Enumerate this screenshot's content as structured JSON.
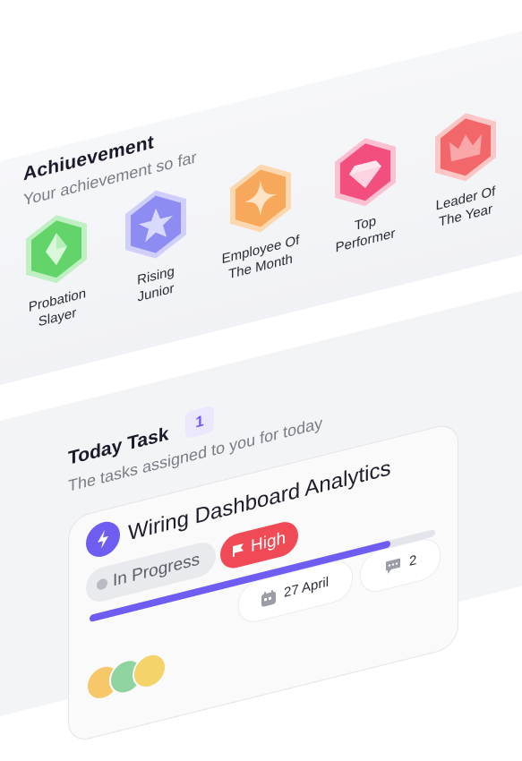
{
  "achievement": {
    "title": "Achiuevement",
    "subtitle": "Your achievement so far",
    "badges": [
      {
        "line1": "Probation",
        "line2": "Slayer",
        "icon": "gem-icon",
        "color": "#62d46a"
      },
      {
        "line1": "Rising",
        "line2": "Junior",
        "icon": "star-icon",
        "color": "#8c8cf2"
      },
      {
        "line1": "Employee Of",
        "line2": "The Month",
        "icon": "sparkle-icon",
        "color": "#f7a85a"
      },
      {
        "line1": "Top",
        "line2": "Performer",
        "icon": "diamond-icon",
        "color": "#f24f7e"
      },
      {
        "line1": "Leader Of",
        "line2": "The Year",
        "icon": "crown-icon",
        "color": "#f2686a"
      }
    ]
  },
  "today_task": {
    "title": "Today Task",
    "count": "1",
    "subtitle": "The tasks assigned to you for today",
    "card": {
      "title": "Wiring Dashboard Analytics",
      "status": "In Progress",
      "priority": "High",
      "progress": 0.87,
      "date": "27 April",
      "comments": "2",
      "accent": "#6f5cf0",
      "priority_color": "#f04a56"
    },
    "avatars": [
      "#f7c86a",
      "#8ed3a0",
      "#f3d36a"
    ]
  }
}
